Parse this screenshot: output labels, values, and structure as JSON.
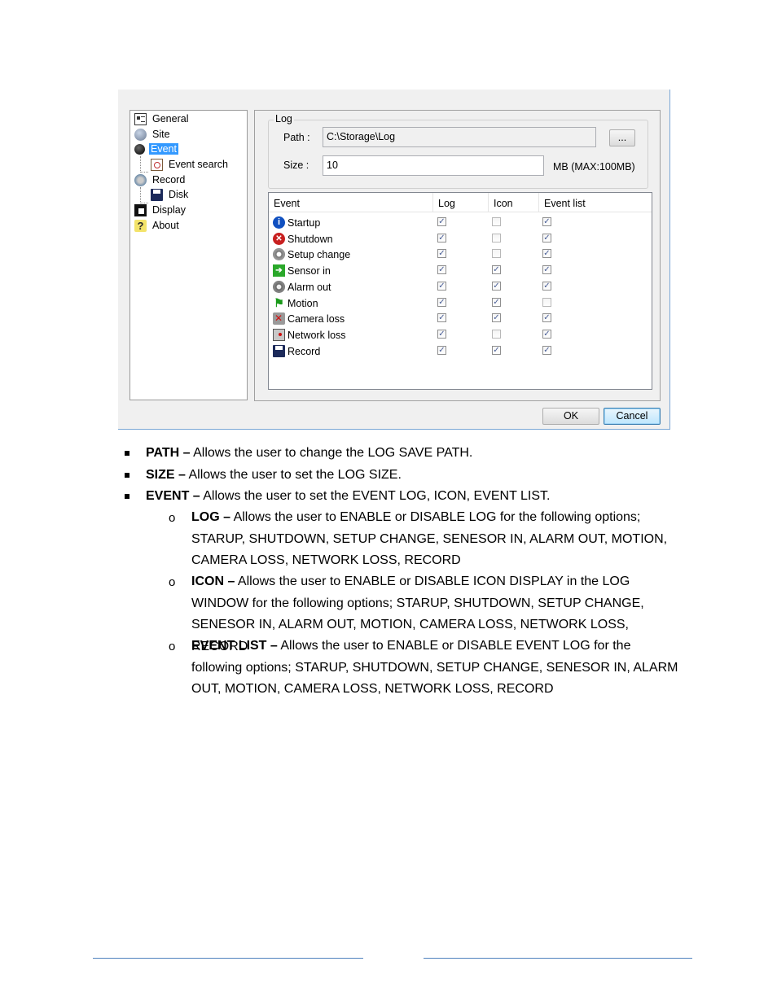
{
  "dialog": {
    "tree": [
      {
        "label": "General",
        "icon": "general-icon"
      },
      {
        "label": "Site",
        "icon": "site-icon"
      },
      {
        "label": "Event",
        "icon": "event-icon",
        "selected": true
      },
      {
        "label": "Event search",
        "icon": "event-search-icon"
      },
      {
        "label": "Record",
        "icon": "record-icon"
      },
      {
        "label": "Disk",
        "icon": "disk-icon"
      },
      {
        "label": "Display",
        "icon": "display-icon"
      },
      {
        "label": "About",
        "icon": "about-icon"
      }
    ],
    "log_group": {
      "title": "Log",
      "path_label": "Path :",
      "path_value": "C:\\Storage\\Log",
      "browse_label": "...",
      "size_label": "Size :",
      "size_value": "10",
      "size_unit": "MB  (MAX:100MB)"
    },
    "event_table": {
      "columns": [
        "Event",
        "Log",
        "Icon",
        "Event list"
      ],
      "rows": [
        {
          "event": "Startup",
          "icon": "info-icon",
          "log": true,
          "icon_enabled": false,
          "event_list": true
        },
        {
          "event": "Shutdown",
          "icon": "shutdown-icon",
          "log": true,
          "icon_enabled": false,
          "event_list": true
        },
        {
          "event": "Setup change",
          "icon": "setup-change-icon",
          "log": true,
          "icon_enabled": false,
          "event_list": true
        },
        {
          "event": "Sensor in",
          "icon": "sensor-in-icon",
          "log": true,
          "icon_enabled": true,
          "event_list": true
        },
        {
          "event": "Alarm out",
          "icon": "alarm-out-icon",
          "log": true,
          "icon_enabled": true,
          "event_list": true
        },
        {
          "event": "Motion",
          "icon": "motion-icon",
          "log": true,
          "icon_enabled": true,
          "event_list": false
        },
        {
          "event": "Camera loss",
          "icon": "camera-loss-icon",
          "log": true,
          "icon_enabled": true,
          "event_list": true
        },
        {
          "event": "Network loss",
          "icon": "network-loss-icon",
          "log": true,
          "icon_enabled": false,
          "event_list": true
        },
        {
          "event": "Record",
          "icon": "record-disk-icon",
          "log": true,
          "icon_enabled": true,
          "event_list": true
        }
      ]
    },
    "buttons": {
      "ok": "OK",
      "cancel": "Cancel"
    }
  },
  "doc": {
    "bullets": [
      {
        "term": "PATH –",
        "text": " Allows the user to change the LOG SAVE PATH."
      },
      {
        "term": "SIZE –",
        "text": " Allows the user to set the LOG SIZE."
      },
      {
        "term": "EVENT –",
        "text": " Allows the user to set the EVENT LOG, ICON, EVENT LIST."
      }
    ],
    "sub_bullets": [
      {
        "marker": "o",
        "term": "LOG –",
        "text": " Allows the user to ENABLE or DISABLE LOG for the following options; STARUP, SHUTDOWN, SETUP CHANGE, SENESOR IN, ALARM OUT, MOTION, CAMERA LOSS, NETWORK LOSS, RECORD"
      },
      {
        "marker": "o",
        "term": "ICON –",
        "text": " Allows the user to ENABLE or DISABLE ICON DISPLAY in the LOG WINDOW for the following options; STARUP, SHUTDOWN, SETUP CHANGE, SENESOR IN, ALARM OUT, MOTION, CAMERA LOSS, NETWORK LOSS, RECORD"
      },
      {
        "marker": "o",
        "term": "EVENT LIST –",
        "text": " Allows the user to ENABLE or DISABLE EVENT LOG for the following options; STARUP, SHUTDOWN, SETUP CHANGE, SENESOR IN, ALARM OUT, MOTION, CAMERA LOSS, NETWORK LOSS, RECORD"
      }
    ]
  },
  "colors": {
    "selection": "#3399ff",
    "footer_rule": "#4f81bd"
  }
}
